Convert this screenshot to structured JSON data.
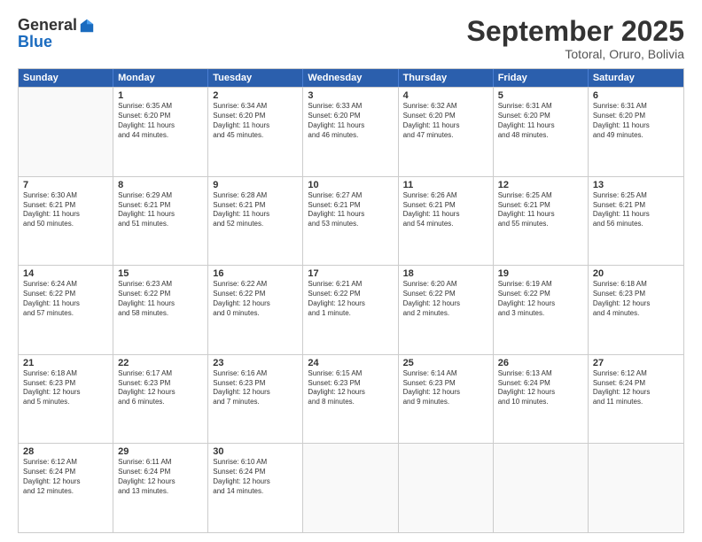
{
  "logo": {
    "general": "General",
    "blue": "Blue"
  },
  "title": "September 2025",
  "location": "Totoral, Oruro, Bolivia",
  "header_days": [
    "Sunday",
    "Monday",
    "Tuesday",
    "Wednesday",
    "Thursday",
    "Friday",
    "Saturday"
  ],
  "weeks": [
    [
      {
        "day": "",
        "text": ""
      },
      {
        "day": "1",
        "text": "Sunrise: 6:35 AM\nSunset: 6:20 PM\nDaylight: 11 hours\nand 44 minutes."
      },
      {
        "day": "2",
        "text": "Sunrise: 6:34 AM\nSunset: 6:20 PM\nDaylight: 11 hours\nand 45 minutes."
      },
      {
        "day": "3",
        "text": "Sunrise: 6:33 AM\nSunset: 6:20 PM\nDaylight: 11 hours\nand 46 minutes."
      },
      {
        "day": "4",
        "text": "Sunrise: 6:32 AM\nSunset: 6:20 PM\nDaylight: 11 hours\nand 47 minutes."
      },
      {
        "day": "5",
        "text": "Sunrise: 6:31 AM\nSunset: 6:20 PM\nDaylight: 11 hours\nand 48 minutes."
      },
      {
        "day": "6",
        "text": "Sunrise: 6:31 AM\nSunset: 6:20 PM\nDaylight: 11 hours\nand 49 minutes."
      }
    ],
    [
      {
        "day": "7",
        "text": "Sunrise: 6:30 AM\nSunset: 6:21 PM\nDaylight: 11 hours\nand 50 minutes."
      },
      {
        "day": "8",
        "text": "Sunrise: 6:29 AM\nSunset: 6:21 PM\nDaylight: 11 hours\nand 51 minutes."
      },
      {
        "day": "9",
        "text": "Sunrise: 6:28 AM\nSunset: 6:21 PM\nDaylight: 11 hours\nand 52 minutes."
      },
      {
        "day": "10",
        "text": "Sunrise: 6:27 AM\nSunset: 6:21 PM\nDaylight: 11 hours\nand 53 minutes."
      },
      {
        "day": "11",
        "text": "Sunrise: 6:26 AM\nSunset: 6:21 PM\nDaylight: 11 hours\nand 54 minutes."
      },
      {
        "day": "12",
        "text": "Sunrise: 6:25 AM\nSunset: 6:21 PM\nDaylight: 11 hours\nand 55 minutes."
      },
      {
        "day": "13",
        "text": "Sunrise: 6:25 AM\nSunset: 6:21 PM\nDaylight: 11 hours\nand 56 minutes."
      }
    ],
    [
      {
        "day": "14",
        "text": "Sunrise: 6:24 AM\nSunset: 6:22 PM\nDaylight: 11 hours\nand 57 minutes."
      },
      {
        "day": "15",
        "text": "Sunrise: 6:23 AM\nSunset: 6:22 PM\nDaylight: 11 hours\nand 58 minutes."
      },
      {
        "day": "16",
        "text": "Sunrise: 6:22 AM\nSunset: 6:22 PM\nDaylight: 12 hours\nand 0 minutes."
      },
      {
        "day": "17",
        "text": "Sunrise: 6:21 AM\nSunset: 6:22 PM\nDaylight: 12 hours\nand 1 minute."
      },
      {
        "day": "18",
        "text": "Sunrise: 6:20 AM\nSunset: 6:22 PM\nDaylight: 12 hours\nand 2 minutes."
      },
      {
        "day": "19",
        "text": "Sunrise: 6:19 AM\nSunset: 6:22 PM\nDaylight: 12 hours\nand 3 minutes."
      },
      {
        "day": "20",
        "text": "Sunrise: 6:18 AM\nSunset: 6:23 PM\nDaylight: 12 hours\nand 4 minutes."
      }
    ],
    [
      {
        "day": "21",
        "text": "Sunrise: 6:18 AM\nSunset: 6:23 PM\nDaylight: 12 hours\nand 5 minutes."
      },
      {
        "day": "22",
        "text": "Sunrise: 6:17 AM\nSunset: 6:23 PM\nDaylight: 12 hours\nand 6 minutes."
      },
      {
        "day": "23",
        "text": "Sunrise: 6:16 AM\nSunset: 6:23 PM\nDaylight: 12 hours\nand 7 minutes."
      },
      {
        "day": "24",
        "text": "Sunrise: 6:15 AM\nSunset: 6:23 PM\nDaylight: 12 hours\nand 8 minutes."
      },
      {
        "day": "25",
        "text": "Sunrise: 6:14 AM\nSunset: 6:23 PM\nDaylight: 12 hours\nand 9 minutes."
      },
      {
        "day": "26",
        "text": "Sunrise: 6:13 AM\nSunset: 6:24 PM\nDaylight: 12 hours\nand 10 minutes."
      },
      {
        "day": "27",
        "text": "Sunrise: 6:12 AM\nSunset: 6:24 PM\nDaylight: 12 hours\nand 11 minutes."
      }
    ],
    [
      {
        "day": "28",
        "text": "Sunrise: 6:12 AM\nSunset: 6:24 PM\nDaylight: 12 hours\nand 12 minutes."
      },
      {
        "day": "29",
        "text": "Sunrise: 6:11 AM\nSunset: 6:24 PM\nDaylight: 12 hours\nand 13 minutes."
      },
      {
        "day": "30",
        "text": "Sunrise: 6:10 AM\nSunset: 6:24 PM\nDaylight: 12 hours\nand 14 minutes."
      },
      {
        "day": "",
        "text": ""
      },
      {
        "day": "",
        "text": ""
      },
      {
        "day": "",
        "text": ""
      },
      {
        "day": "",
        "text": ""
      }
    ]
  ]
}
